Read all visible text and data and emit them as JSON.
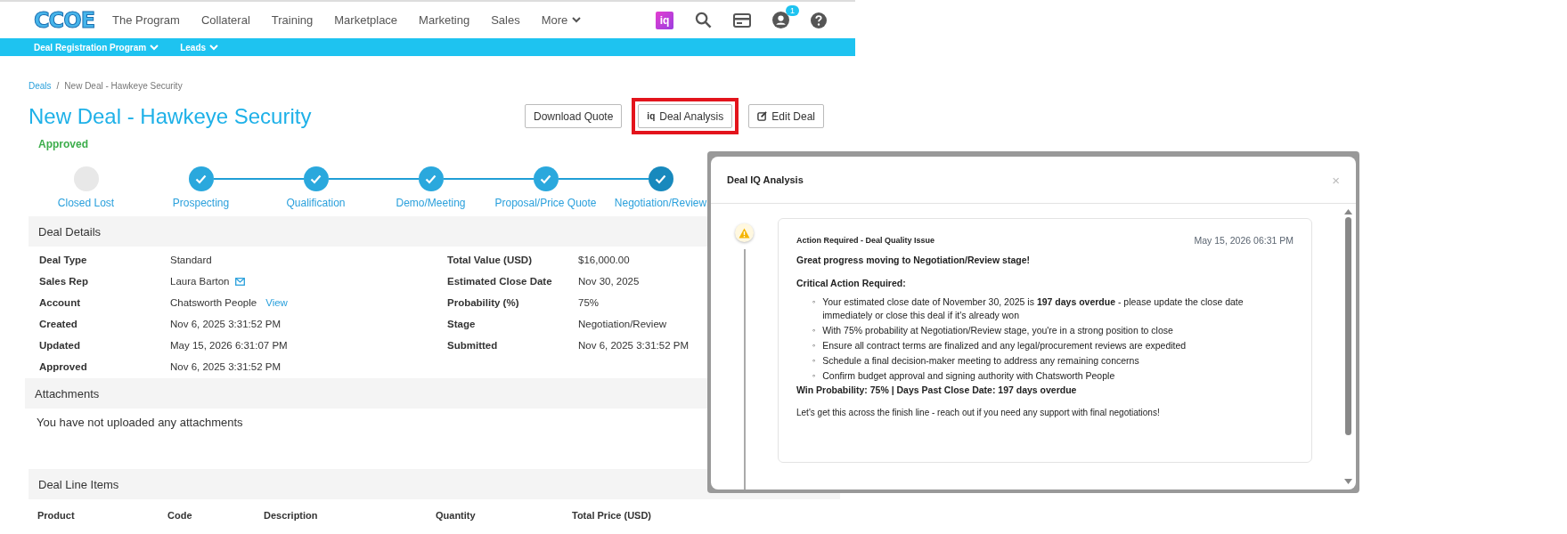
{
  "logo": {
    "text": "CCOE"
  },
  "nav": {
    "items": [
      {
        "label": "The Program",
        "dropdown": false
      },
      {
        "label": "Collateral",
        "dropdown": false
      },
      {
        "label": "Training",
        "dropdown": false
      },
      {
        "label": "Marketplace",
        "dropdown": false
      },
      {
        "label": "Marketing",
        "dropdown": false
      },
      {
        "label": "Sales",
        "dropdown": false
      },
      {
        "label": "More",
        "dropdown": true
      }
    ],
    "iq_badge": "iq",
    "notification_count": "1"
  },
  "subnav": [
    {
      "label": "Deal Registration Program"
    },
    {
      "label": "Leads"
    }
  ],
  "breadcrumb_separator": "/",
  "breadcrumb": [
    {
      "label": "Deals",
      "link": true
    },
    {
      "label": "New Deal - Hawkeye Security",
      "link": false
    }
  ],
  "title": "New Deal - Hawkeye Security",
  "status": "Approved",
  "actions": [
    {
      "label": "Download Quote",
      "kind": "plain",
      "highlighted": false
    },
    {
      "label": "Deal Analysis",
      "kind": "iq",
      "icon_text": "iq",
      "highlighted": true
    },
    {
      "label": "Edit Deal",
      "kind": "edit",
      "highlighted": false
    }
  ],
  "stages": [
    {
      "label": "Closed Lost",
      "done": false,
      "current": false
    },
    {
      "label": "Prospecting",
      "done": true,
      "current": false
    },
    {
      "label": "Qualification",
      "done": true,
      "current": false
    },
    {
      "label": "Demo/Meeting",
      "done": true,
      "current": false
    },
    {
      "label": "Proposal/Price Quote",
      "done": true,
      "current": false
    },
    {
      "label": "Negotiation/Review",
      "done": true,
      "current": true
    }
  ],
  "deal_details": {
    "title": "Deal Details",
    "left": [
      {
        "label": "Deal Type",
        "value": "Standard",
        "kind": "text"
      },
      {
        "label": "Sales Rep",
        "value": "Laura Barton",
        "kind": "email"
      },
      {
        "label": "Account",
        "value": "Chatsworth People",
        "kind": "link",
        "link": "View"
      },
      {
        "label": "Created",
        "value": "Nov 6, 2025 3:31:52 PM",
        "kind": "text"
      },
      {
        "label": "Updated",
        "value": "May 15, 2026 6:31:07 PM",
        "kind": "text"
      },
      {
        "label": "Approved",
        "value": "Nov 6, 2025 3:31:52 PM",
        "kind": "text"
      }
    ],
    "right": [
      {
        "label": "Total Value (USD)",
        "value": "$16,000.00"
      },
      {
        "label": "Estimated Close Date",
        "value": "Nov 30, 2025"
      },
      {
        "label": "Probability (%)",
        "value": "75%"
      },
      {
        "label": "Stage",
        "value": "Negotiation/Review"
      },
      {
        "label": "Submitted",
        "value": "Nov 6, 2025 3:31:52 PM"
      }
    ]
  },
  "attachments": {
    "title": "Attachments",
    "empty_text": "You have not uploaded any attachments"
  },
  "line_items": {
    "title": "Deal Line Items",
    "columns": [
      "Product",
      "Code",
      "Description",
      "Quantity",
      "Total Price (USD)"
    ]
  },
  "modal": {
    "title": "Deal IQ Analysis",
    "close": "×",
    "entry": {
      "title": "Action Required - Deal Quality Issue",
      "timestamp": "May 15, 2026 06:31 PM",
      "greeting": "Great progress moving to Negotiation/Review stage!",
      "heading": "Critical Action Required:",
      "bullet_marker": "◦",
      "bullets": [
        "Your estimated close date of November 30, 2025 is **197 days overdue** - please update the close date immediately or close this deal if it's already won",
        "With 75% probability at Negotiation/Review stage, you're in a strong position to close",
        "Ensure all contract terms are finalized and any legal/procurement reviews are expedited",
        "Schedule a final decision-maker meeting to address any remaining concerns",
        "Confirm budget approval and signing authority with Chatsworth People"
      ],
      "summary": "Win Probability: 75% | Days Past Close Date: 197 days overdue",
      "closing": "Let's get this across the finish line - reach out if you need any support with final negotiations!"
    }
  }
}
